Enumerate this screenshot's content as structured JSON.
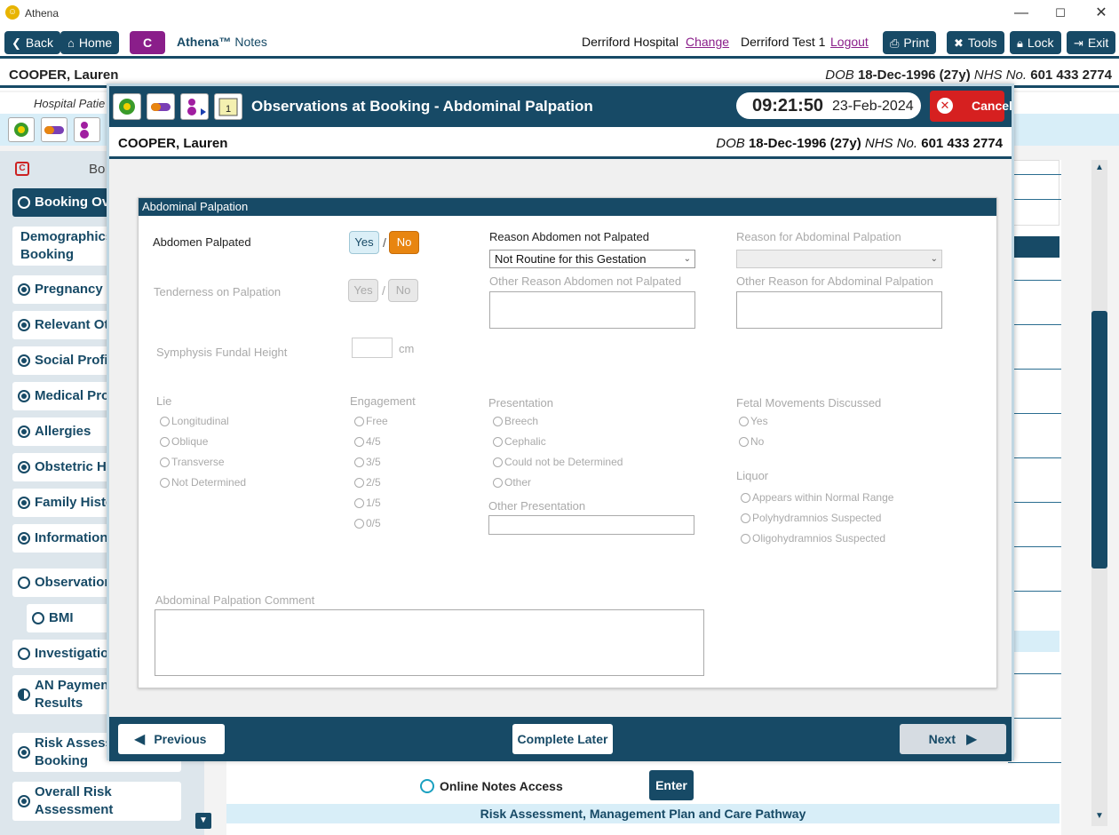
{
  "window": {
    "title": "Athena",
    "minimize": "—",
    "maximize": "☐",
    "close": "✕"
  },
  "toolbar": {
    "back": "Back",
    "home": "Home",
    "c_label": "C",
    "app_name": "Athena™",
    "app_sub": "Notes",
    "hospital": "Derriford Hospital",
    "change": "Change",
    "user": "Derriford Test 1",
    "logout": "Logout",
    "print": "Print",
    "tools": "Tools",
    "lock": "Lock",
    "exit": "Exit"
  },
  "patient": {
    "name": "COOPER, Lauren",
    "dob_label": "DOB",
    "dob": "18-Dec-1996 (27y)",
    "nhs_label": "NHS No.",
    "nhs": "601 433 2774"
  },
  "background": {
    "hospital_patient": "Hospital Patie",
    "panel_header": "Bo",
    "online_notes": "Online Notes Access",
    "enter": "Enter",
    "risk_title": "Risk Assessment, Management Plan and Care Pathway"
  },
  "nav": [
    {
      "label": "Booking Ov",
      "state": "empty",
      "active": true
    },
    {
      "label": "Demographics",
      "label2": "Booking",
      "state": "none"
    },
    {
      "label": "Pregnancy I",
      "state": "fill"
    },
    {
      "label": "Relevant Ot",
      "state": "fill"
    },
    {
      "label": "Social Profil",
      "state": "fill"
    },
    {
      "label": "Medical Pro",
      "state": "fill"
    },
    {
      "label": "Allergies",
      "state": "fill"
    },
    {
      "label": "Obstetric H",
      "state": "fill"
    },
    {
      "label": "Family Histo",
      "state": "fill"
    },
    {
      "label": "Information",
      "state": "fill"
    },
    {
      "label": "Observation",
      "state": "empty"
    },
    {
      "label": "BMI",
      "state": "empty"
    },
    {
      "label": "Investigatio",
      "state": "empty"
    },
    {
      "label": "AN Paymen",
      "label2": "Results",
      "state": "half"
    },
    {
      "label": "Risk Assess",
      "label2": "Booking",
      "state": "fill"
    },
    {
      "label": "Overall Risk",
      "label2": "Assessment",
      "state": "fill"
    }
  ],
  "modal": {
    "title": "Observations at Booking - Abdominal Palpation",
    "time": "09:21:50",
    "date": "23-Feb-2024",
    "cancel": "Cancel",
    "section": "Abdominal Palpation",
    "abdomen_palpated": "Abdomen Palpated",
    "yes": "Yes",
    "no": "No",
    "slash": "/",
    "reason_not_palpated": "Reason Abdomen not Palpated",
    "reason_not_palpated_value": "Not Routine for this Gestation",
    "reason_for_palpation": "Reason for Abdominal Palpation",
    "tenderness": "Tenderness on Palpation",
    "other_reason_not": "Other Reason Abdomen not Palpated",
    "other_reason_for": "Other Reason for Abdominal Palpation",
    "sfh": "Symphysis Fundal Height",
    "cm": "cm",
    "lie": "Lie",
    "lie_options": [
      "Longitudinal",
      "Oblique",
      "Transverse",
      "Not Determined"
    ],
    "engagement": "Engagement",
    "engagement_options": [
      "Free",
      "4/5",
      "3/5",
      "2/5",
      "1/5",
      "0/5"
    ],
    "presentation": "Presentation",
    "presentation_options": [
      "Breech",
      "Cephalic",
      "Could not be Determined",
      "Other"
    ],
    "other_presentation": "Other Presentation",
    "fetal_movements": "Fetal Movements Discussed",
    "fetal_options": [
      "Yes",
      "No"
    ],
    "liquor": "Liquor",
    "liquor_options": [
      "Appears within Normal Range",
      "Polyhydramnios Suspected",
      "Oligohydramnios Suspected"
    ],
    "comment": "Abdominal Palpation Comment",
    "previous": "Previous",
    "complete_later": "Complete Later",
    "next": "Next"
  }
}
